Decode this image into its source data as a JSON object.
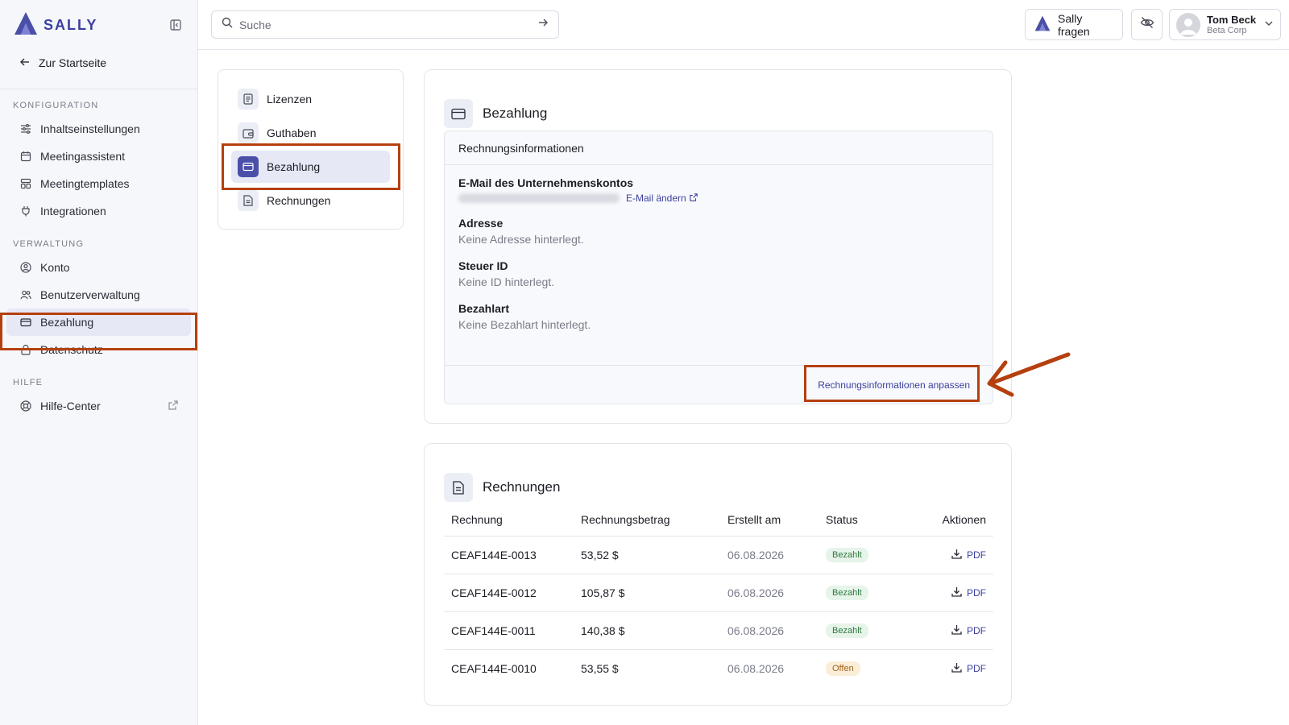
{
  "brand": {
    "name": "SALLY",
    "accent": "#4a4fa8",
    "highlight": "#b5400f"
  },
  "sidebar": {
    "back_label": "Zur Startseite",
    "sections": [
      {
        "label": "KONFIGURATION",
        "items": [
          {
            "label": "Inhaltseinstellungen",
            "icon": "sliders-icon"
          },
          {
            "label": "Meetingassistent",
            "icon": "calendar-icon"
          },
          {
            "label": "Meetingtemplates",
            "icon": "template-icon"
          },
          {
            "label": "Integrationen",
            "icon": "plug-icon"
          }
        ]
      },
      {
        "label": "VERWALTUNG",
        "items": [
          {
            "label": "Konto",
            "icon": "user-circle-icon"
          },
          {
            "label": "Benutzerverwaltung",
            "icon": "users-icon"
          },
          {
            "label": "Bezahlung",
            "icon": "credit-card-icon",
            "active": true
          },
          {
            "label": "Datenschutz",
            "icon": "lock-icon"
          }
        ]
      },
      {
        "label": "HILFE",
        "items": [
          {
            "label": "Hilfe-Center",
            "icon": "lifebuoy-icon"
          }
        ]
      }
    ]
  },
  "topbar": {
    "search_placeholder": "Suche",
    "ask_label": "Sally fragen",
    "user": {
      "name": "Tom Beck",
      "org": "Beta Corp"
    }
  },
  "subnav": {
    "items": [
      {
        "label": "Lizenzen"
      },
      {
        "label": "Guthaben"
      },
      {
        "label": "Bezahlung",
        "active": true
      },
      {
        "label": "Rechnungen"
      }
    ]
  },
  "billing": {
    "title": "Bezahlung",
    "section_title": "Rechnungsinformationen",
    "email_label": "E-Mail des Unternehmenskontos",
    "email_change": "E-Mail ändern",
    "address_label": "Adresse",
    "address_value": "Keine Adresse hinterlegt.",
    "tax_label": "Steuer ID",
    "tax_value": "Keine ID hinterlegt.",
    "payment_label": "Bezahlart",
    "payment_value": "Keine Bezahlart hinterlegt.",
    "edit_button": "Rechnungsinformationen anpassen"
  },
  "invoices": {
    "title": "Rechnungen",
    "columns": [
      "Rechnung",
      "Rechnungsbetrag",
      "Erstellt am",
      "Status",
      "Aktionen"
    ],
    "rows": [
      {
        "id": "CEAF144E-0013",
        "amount": "53,52 $",
        "date": "06.08.2026",
        "status": "Bezahlt",
        "action": "PDF"
      },
      {
        "id": "CEAF144E-0012",
        "amount": "105,87 $",
        "date": "06.08.2026",
        "status": "Bezahlt",
        "action": "PDF"
      },
      {
        "id": "CEAF144E-0011",
        "amount": "140,38 $",
        "date": "06.08.2026",
        "status": "Bezahlt",
        "action": "PDF"
      },
      {
        "id": "CEAF144E-0010",
        "amount": "53,55 $",
        "date": "06.08.2026",
        "status": "Offen",
        "action": "PDF"
      }
    ]
  }
}
